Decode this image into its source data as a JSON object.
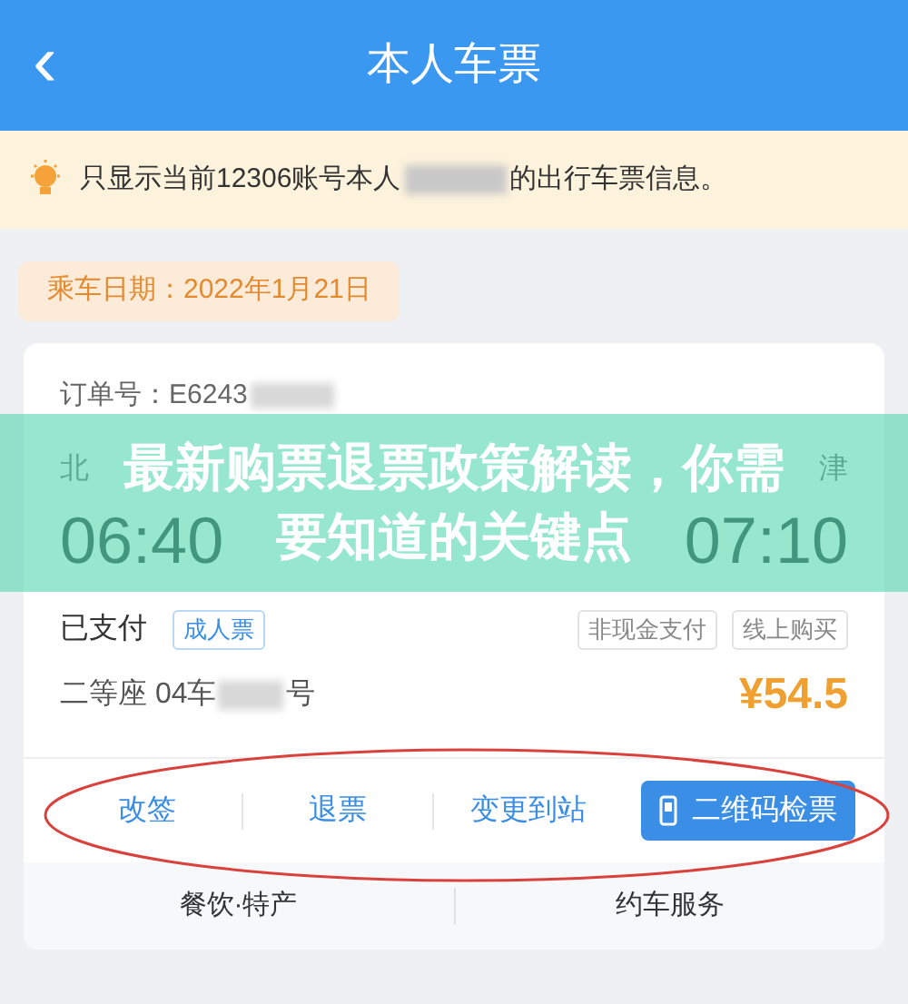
{
  "header": {
    "back": "‹",
    "title": "本人车票"
  },
  "notice": {
    "text_before": "只显示当前12306账号本人",
    "text_after": "的出行车票信息。"
  },
  "travel_date": "乘车日期：2022年1月21日",
  "ticket": {
    "order": "订单号：E6243",
    "from_station": "北",
    "to_station": "津",
    "depart_time": "06:40",
    "arrive_time": "07:10",
    "payment_status": "已支付",
    "ticket_type": "成人票",
    "tags": [
      "非现金支付",
      "线上购买"
    ],
    "seat_before": "二等座 04车",
    "seat_after": "号",
    "price": "¥54.5",
    "actions": [
      {
        "kind": "link",
        "label": "改签"
      },
      {
        "kind": "link",
        "label": "退票"
      },
      {
        "kind": "link",
        "label": "变更到站"
      },
      {
        "kind": "button",
        "label": "二维码检票"
      }
    ],
    "services": [
      "餐饮·特产",
      "约车服务"
    ]
  },
  "overlay_title": [
    "最新购票退票政策解读，你需",
    "要知道的关键点"
  ]
}
